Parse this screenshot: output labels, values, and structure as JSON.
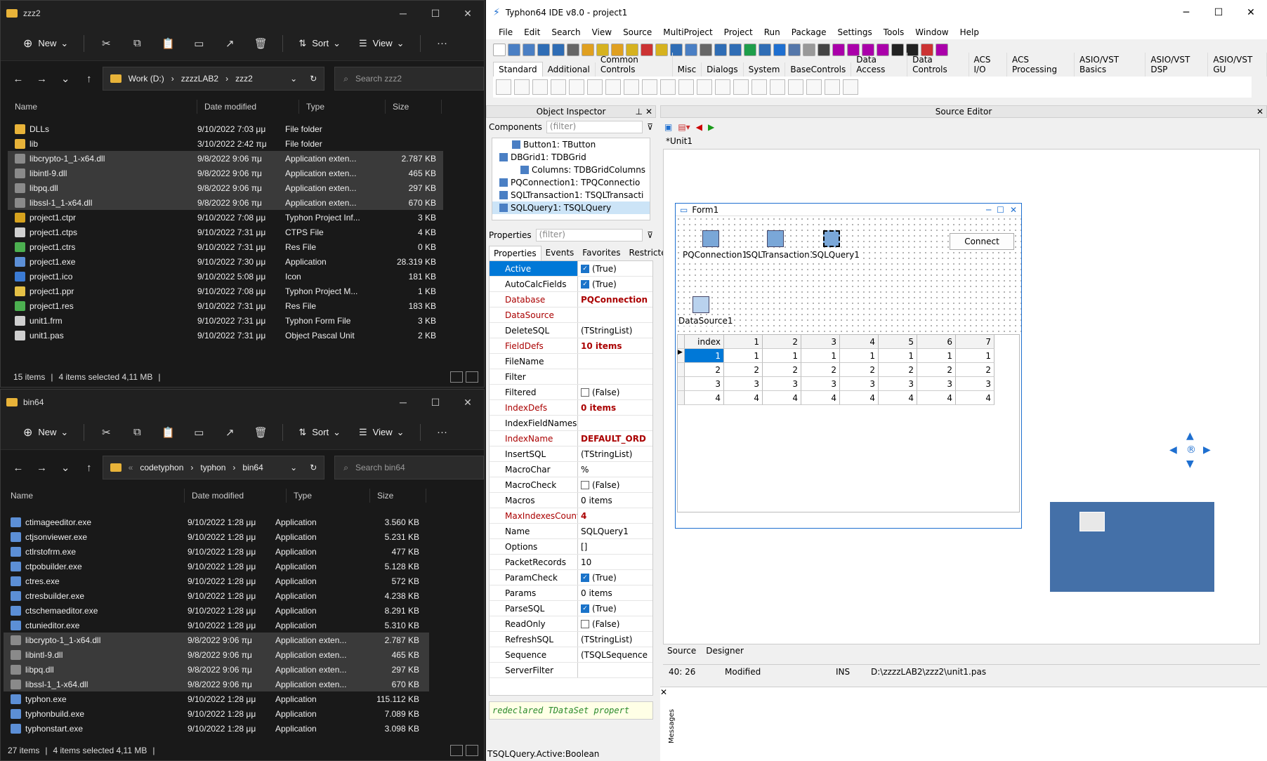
{
  "explorer_top": {
    "title": "zzz2",
    "toolbar": {
      "new": "New",
      "sort": "Sort",
      "view": "View"
    },
    "breadcrumb": [
      "Work (D:)",
      "zzzzLAB2",
      "zzz2"
    ],
    "search_placeholder": "Search zzz2",
    "columns": [
      "Name",
      "Date modified",
      "Type",
      "Size"
    ],
    "files": [
      {
        "name": "DLLs",
        "date": "9/10/2022 7:03 μμ",
        "type": "File folder",
        "size": "",
        "icon": "folder",
        "sel": false
      },
      {
        "name": "lib",
        "date": "3/10/2022 2:42 πμ",
        "type": "File folder",
        "size": "",
        "icon": "folder",
        "sel": false
      },
      {
        "name": "libcrypto-1_1-x64.dll",
        "date": "9/8/2022 9:06 πμ",
        "type": "Application exten...",
        "size": "2.787 KB",
        "icon": "dll",
        "sel": true
      },
      {
        "name": "libintl-9.dll",
        "date": "9/8/2022 9:06 πμ",
        "type": "Application exten...",
        "size": "465 KB",
        "icon": "dll",
        "sel": true
      },
      {
        "name": "libpq.dll",
        "date": "9/8/2022 9:06 πμ",
        "type": "Application exten...",
        "size": "297 KB",
        "icon": "dll",
        "sel": true
      },
      {
        "name": "libssl-1_1-x64.dll",
        "date": "9/8/2022 9:06 πμ",
        "type": "Application exten...",
        "size": "670 KB",
        "icon": "dll",
        "sel": true
      },
      {
        "name": "project1.ctpr",
        "date": "9/10/2022 7:08 μμ",
        "type": "Typhon Project Inf...",
        "size": "3 KB",
        "icon": "ctpr",
        "sel": false
      },
      {
        "name": "project1.ctps",
        "date": "9/10/2022 7:31 μμ",
        "type": "CTPS File",
        "size": "4 KB",
        "icon": "file",
        "sel": false
      },
      {
        "name": "project1.ctrs",
        "date": "9/10/2022 7:31 μμ",
        "type": "Res File",
        "size": "0 KB",
        "icon": "res",
        "sel": false
      },
      {
        "name": "project1.exe",
        "date": "9/10/2022 7:30 μμ",
        "type": "Application",
        "size": "28.319 KB",
        "icon": "exe",
        "sel": false
      },
      {
        "name": "project1.ico",
        "date": "9/10/2022 5:08 μμ",
        "type": "Icon",
        "size": "181 KB",
        "icon": "ico",
        "sel": false
      },
      {
        "name": "project1.ppr",
        "date": "9/10/2022 7:08 μμ",
        "type": "Typhon Project M...",
        "size": "1 KB",
        "icon": "ppr",
        "sel": false
      },
      {
        "name": "project1.res",
        "date": "9/10/2022 7:31 μμ",
        "type": "Res File",
        "size": "183 KB",
        "icon": "res",
        "sel": false
      },
      {
        "name": "unit1.frm",
        "date": "9/10/2022 7:31 μμ",
        "type": "Typhon Form File",
        "size": "3 KB",
        "icon": "file",
        "sel": false
      },
      {
        "name": "unit1.pas",
        "date": "9/10/2022 7:31 μμ",
        "type": "Object Pascal Unit",
        "size": "2 KB",
        "icon": "file",
        "sel": false
      }
    ],
    "status": {
      "count": "15 items",
      "selected": "4 items selected  4,11 MB"
    }
  },
  "explorer_bottom": {
    "title": "bin64",
    "toolbar": {
      "new": "New",
      "sort": "Sort",
      "view": "View"
    },
    "breadcrumb": [
      "codetyphon",
      "typhon",
      "bin64"
    ],
    "search_placeholder": "Search bin64",
    "columns": [
      "Name",
      "Date modified",
      "Type",
      "Size"
    ],
    "files": [
      {
        "name": "ctimageeditor.exe",
        "date": "9/10/2022 1:28 μμ",
        "type": "Application",
        "size": "3.560 KB",
        "icon": "exe",
        "sel": false
      },
      {
        "name": "ctjsonviewer.exe",
        "date": "9/10/2022 1:28 μμ",
        "type": "Application",
        "size": "5.231 KB",
        "icon": "exe",
        "sel": false
      },
      {
        "name": "ctlrstofrm.exe",
        "date": "9/10/2022 1:28 μμ",
        "type": "Application",
        "size": "477 KB",
        "icon": "exe",
        "sel": false
      },
      {
        "name": "ctpobuilder.exe",
        "date": "9/10/2022 1:28 μμ",
        "type": "Application",
        "size": "5.128 KB",
        "icon": "exe",
        "sel": false
      },
      {
        "name": "ctres.exe",
        "date": "9/10/2022 1:28 μμ",
        "type": "Application",
        "size": "572 KB",
        "icon": "exe",
        "sel": false
      },
      {
        "name": "ctresbuilder.exe",
        "date": "9/10/2022 1:28 μμ",
        "type": "Application",
        "size": "4.238 KB",
        "icon": "exe",
        "sel": false
      },
      {
        "name": "ctschemaeditor.exe",
        "date": "9/10/2022 1:28 μμ",
        "type": "Application",
        "size": "8.291 KB",
        "icon": "exe",
        "sel": false
      },
      {
        "name": "ctunieditor.exe",
        "date": "9/10/2022 1:28 μμ",
        "type": "Application",
        "size": "5.310 KB",
        "icon": "exe",
        "sel": false
      },
      {
        "name": "libcrypto-1_1-x64.dll",
        "date": "9/8/2022 9:06 πμ",
        "type": "Application exten...",
        "size": "2.787 KB",
        "icon": "dll",
        "sel": true
      },
      {
        "name": "libintl-9.dll",
        "date": "9/8/2022 9:06 πμ",
        "type": "Application exten...",
        "size": "465 KB",
        "icon": "dll",
        "sel": true
      },
      {
        "name": "libpq.dll",
        "date": "9/8/2022 9:06 πμ",
        "type": "Application exten...",
        "size": "297 KB",
        "icon": "dll",
        "sel": true
      },
      {
        "name": "libssl-1_1-x64.dll",
        "date": "9/8/2022 9:06 πμ",
        "type": "Application exten...",
        "size": "670 KB",
        "icon": "dll",
        "sel": true
      },
      {
        "name": "typhon.exe",
        "date": "9/10/2022 1:28 μμ",
        "type": "Application",
        "size": "115.112 KB",
        "icon": "exe",
        "sel": false
      },
      {
        "name": "typhonbuild.exe",
        "date": "9/10/2022 1:28 μμ",
        "type": "Application",
        "size": "7.089 KB",
        "icon": "exe",
        "sel": false
      },
      {
        "name": "typhonstart.exe",
        "date": "9/10/2022 1:28 μμ",
        "type": "Application",
        "size": "3.098 KB",
        "icon": "exe",
        "sel": false
      }
    ],
    "status": {
      "count": "27 items",
      "selected": "4 items selected  4,11 MB"
    }
  },
  "ide": {
    "title": "Typhon64 IDE v8.0 - project1",
    "menu": [
      "File",
      "Edit",
      "Search",
      "View",
      "Source",
      "MultiProject",
      "Project",
      "Run",
      "Package",
      "Settings",
      "Tools",
      "Window",
      "Help"
    ],
    "palette_tabs": [
      "Standard",
      "Additional",
      "Common Controls",
      "Misc",
      "Dialogs",
      "System",
      "BaseControls",
      "Data Access",
      "Data Controls",
      "ACS I/O",
      "ACS Processing",
      "ASIO/VST Basics",
      "ASIO/VST DSP",
      "ASIO/VST GU"
    ],
    "oi": {
      "header": "Object Inspector",
      "components_label": "Components",
      "filter": "(filter)",
      "tree": [
        "Button1: TButton",
        "DBGrid1: TDBGrid",
        "Columns: TDBGridColumns",
        "PQConnection1: TPQConnectio",
        "SQLTransaction1: TSQLTransacti",
        "SQLQuery1: TSQLQuery"
      ],
      "properties_label": "Properties",
      "tabs": [
        "Properties",
        "Events",
        "Favorites",
        "Restricted"
      ],
      "props": [
        {
          "k": "Active",
          "v": "(True)",
          "cb": "on",
          "hl": true
        },
        {
          "k": "AutoCalcFields",
          "v": "(True)",
          "cb": "on"
        },
        {
          "k": "Database",
          "v": "PQConnection",
          "red": true
        },
        {
          "k": "DataSource",
          "v": "",
          "red": true
        },
        {
          "k": "DeleteSQL",
          "v": "(TStringList)"
        },
        {
          "k": "FieldDefs",
          "v": "10 items",
          "red": true
        },
        {
          "k": "FileName",
          "v": ""
        },
        {
          "k": "Filter",
          "v": ""
        },
        {
          "k": "Filtered",
          "v": "(False)",
          "cb": "off"
        },
        {
          "k": "IndexDefs",
          "v": "0 items",
          "red": true
        },
        {
          "k": "IndexFieldNames",
          "v": ""
        },
        {
          "k": "IndexName",
          "v": "DEFAULT_ORD",
          "red": true
        },
        {
          "k": "InsertSQL",
          "v": "(TStringList)"
        },
        {
          "k": "MacroChar",
          "v": "%"
        },
        {
          "k": "MacroCheck",
          "v": "(False)",
          "cb": "off"
        },
        {
          "k": "Macros",
          "v": "0 items"
        },
        {
          "k": "MaxIndexesCount",
          "v": "4",
          "red": true
        },
        {
          "k": "Name",
          "v": "SQLQuery1"
        },
        {
          "k": "Options",
          "v": "[]"
        },
        {
          "k": "PacketRecords",
          "v": "10"
        },
        {
          "k": "ParamCheck",
          "v": "(True)",
          "cb": "on"
        },
        {
          "k": "Params",
          "v": "0 items"
        },
        {
          "k": "ParseSQL",
          "v": "(True)",
          "cb": "on"
        },
        {
          "k": "ReadOnly",
          "v": "(False)",
          "cb": "off"
        },
        {
          "k": "RefreshSQL",
          "v": "(TStringList)"
        },
        {
          "k": "Sequence",
          "v": "(TSQLSequence"
        },
        {
          "k": "ServerFilter",
          "v": ""
        }
      ],
      "hint": "redeclared TDataSet propert",
      "status": "TSQLQuery.Active:Boolean"
    },
    "editor": {
      "header": "Source Editor",
      "tab": "*Unit1",
      "form_title": "Form1",
      "components": [
        "PQConnection1",
        "SQLTransaction1",
        "SQLQuery1",
        "DataSource1"
      ],
      "connect_label": "Connect",
      "grid_head": [
        "index",
        "1",
        "2",
        "3",
        "4",
        "5",
        "6",
        "7"
      ],
      "grid_rows": [
        [
          "1",
          "1",
          "1",
          "1",
          "1",
          "1",
          "1",
          "1"
        ],
        [
          "2",
          "2",
          "2",
          "2",
          "2",
          "2",
          "2",
          "2"
        ],
        [
          "3",
          "3",
          "3",
          "3",
          "3",
          "3",
          "3",
          "3"
        ],
        [
          "4",
          "4",
          "4",
          "4",
          "4",
          "4",
          "4",
          "4"
        ]
      ],
      "bottom_tabs": [
        "Source",
        "Designer"
      ],
      "status": {
        "pos": "40: 26",
        "state": "Modified",
        "mode": "INS",
        "file": "D:\\zzzzLAB2\\zzz2\\unit1.pas"
      },
      "messages_label": "Messages"
    }
  }
}
